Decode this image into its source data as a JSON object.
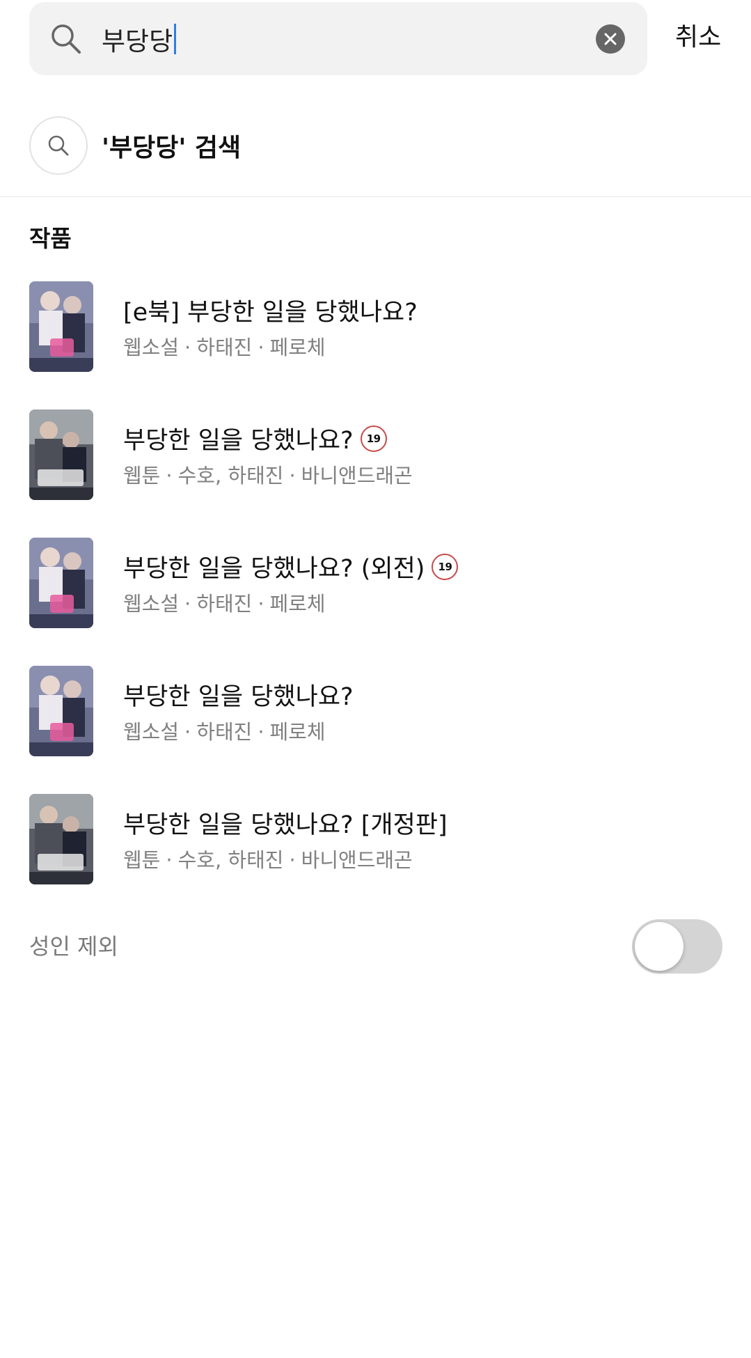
{
  "search": {
    "query": "부당당",
    "cancel_label": "취소"
  },
  "suggestion": {
    "label": "'부당당' 검색"
  },
  "section": {
    "title": "작품"
  },
  "results": [
    {
      "title": "[e북] 부당한 일을 당했나요?",
      "adult": false,
      "genre": "웹소설",
      "authors": "하태진",
      "publisher": "페로체",
      "cover": "novel"
    },
    {
      "title": "부당한 일을 당했나요?",
      "adult": true,
      "badge": "19",
      "genre": "웹툰",
      "authors": "수호, 하태진",
      "publisher": "바니앤드래곤",
      "cover": "webtoon"
    },
    {
      "title": "부당한 일을 당했나요? (외전)",
      "adult": true,
      "badge": "19",
      "genre": "웹소설",
      "authors": "하태진",
      "publisher": "페로체",
      "cover": "novel"
    },
    {
      "title": "부당한 일을 당했나요?",
      "adult": false,
      "genre": "웹소설",
      "authors": "하태진",
      "publisher": "페로체",
      "cover": "novel"
    },
    {
      "title": "부당한 일을 당했나요? [개정판]",
      "adult": false,
      "genre": "웹툰",
      "authors": "수호, 하태진",
      "publisher": "바니앤드래곤",
      "cover": "webtoon"
    }
  ],
  "filter": {
    "label": "성인 제외",
    "enabled": false
  },
  "colors": {
    "search_bg": "#f2f2f2",
    "caret": "#2f7de1",
    "badge_border": "#c84a4a",
    "meta_text": "#808080",
    "toggle_off": "#d4d4d4"
  }
}
